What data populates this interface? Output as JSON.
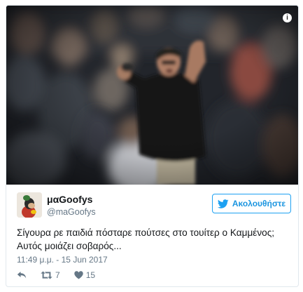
{
  "tweet": {
    "display_name": "μαGoofys",
    "handle": "@maGoofys",
    "text_line1": "Σίγουρα ρε παιδιά πόσταρε πούτσες στο τουίτερ ο Καμμένος;",
    "text_line2": "Αυτός μοιάζει σοβαρός...",
    "timestamp": "11:49 μ.μ. - 15 Jun 2017",
    "follow_label": "Ακολουθήστε",
    "retweet_count": "7",
    "like_count": "15"
  },
  "media": {
    "info_glyph": "i"
  },
  "icons": {
    "twitter_bird": "twitter-bird-icon",
    "reply": "reply-icon",
    "retweet": "retweet-icon",
    "like": "heart-icon",
    "info": "info-icon"
  },
  "colors": {
    "accent": "#1da1f2",
    "text": "#14171a",
    "muted": "#657786",
    "border": "#e1e8ed"
  }
}
